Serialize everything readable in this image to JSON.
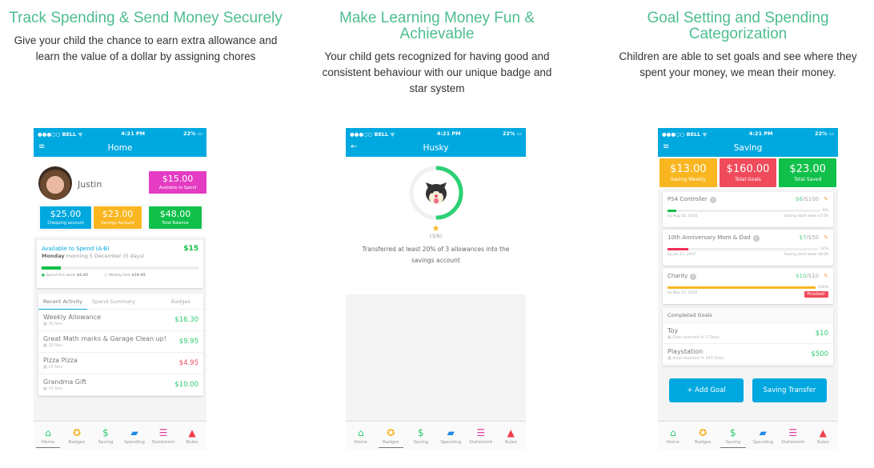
{
  "features": [
    {
      "title": "Track Spending & Send Money Securely",
      "desc": "Give your child the chance to earn extra allowance and learn the value of a dollar by assigning chores"
    },
    {
      "title": "Make Learning Money Fun & Achievable",
      "desc": "Your child gets recognized for having good and consistent behaviour with our unique badge and star system"
    },
    {
      "title": "Goal Setting and Spending Categorization",
      "desc": "Children are able to set goals and see where they spent your money, we mean their money."
    }
  ],
  "status": {
    "carrier": "●●●○○ BELL ᯤ",
    "time": "4:21 PM",
    "battery": "22% ▭"
  },
  "tabs": [
    {
      "label": "Home",
      "icon": "home-icon",
      "glyph": "⌂",
      "color": "#2ecc71"
    },
    {
      "label": "Badges",
      "icon": "badge-icon",
      "glyph": "✪",
      "color": "#f5b223"
    },
    {
      "label": "Saving",
      "icon": "piggy-bank-icon",
      "glyph": "$",
      "color": "#2ecc71"
    },
    {
      "label": "Spending",
      "icon": "card-icon",
      "glyph": "▰",
      "color": "#1e88e5"
    },
    {
      "label": "Statement",
      "icon": "list-icon",
      "glyph": "☰",
      "color": "#e040a0"
    },
    {
      "label": "Rules",
      "icon": "warning-icon",
      "glyph": "▲",
      "color": "#f03c4b"
    }
  ],
  "home": {
    "title": "Home",
    "menu_glyph": "≡",
    "name": "Justin",
    "available": {
      "amount": "$15.00",
      "label": "Available to Spend"
    },
    "balances": [
      {
        "amount": "$25.00",
        "label": "Chequing account",
        "color": "#00a8e0"
      },
      {
        "amount": "$23.00",
        "label": "Savings Account",
        "color": "#f9b620"
      },
      {
        "amount": "$48.00",
        "label": "Total Balance",
        "color": "#10c04a"
      }
    ],
    "spend_card": {
      "title": "Available to Spend (A-B)",
      "amount": "$15",
      "day": "Monday",
      "when": " morning 5 December ",
      "days": "(5 days)",
      "progress": 0.12,
      "spent_label": "Spend this week ",
      "spent": "$4.95",
      "limit_label": "Weekly limit ",
      "limit": "$19.95"
    },
    "activity_tabs": [
      "Recent Activity",
      "Spend Summary",
      "Badges"
    ],
    "activity": [
      {
        "title": "Weekly Allowance",
        "date": "30 Nov",
        "amount": "$16.30",
        "color": "#2ecc71"
      },
      {
        "title": "Great Math marks & Garage Clean up!",
        "date": "29 Nov",
        "amount": "$9.95",
        "color": "#2ecc71"
      },
      {
        "title": "Pizza Pizza",
        "date": "15 Nov",
        "amount": "$4.95",
        "color": "#e74c5c"
      },
      {
        "title": "Grandma Gift",
        "date": "15 Nov",
        "amount": "$10.00",
        "color": "#2ecc71"
      }
    ]
  },
  "husky": {
    "title": "Husky",
    "back_glyph": "←",
    "progress": 0.5,
    "stars": "★",
    "count": "(3/6)",
    "desc": "Transferred at least 20% of 3 allowances into the savings account"
  },
  "saving": {
    "title": "Saving",
    "totals": [
      {
        "amount": "$13.00",
        "label": "Saving Weekly",
        "color": "#f9b620"
      },
      {
        "amount": "$160.00",
        "label": "Total Goals",
        "color": "#f04b5b"
      },
      {
        "amount": "$23.00",
        "label": "Total Saved",
        "color": "#10c04a"
      }
    ],
    "goals": [
      {
        "name": "PS4 Controller",
        "saved": "$6",
        "target": "/$100",
        "pct": "6%",
        "progress": 0.06,
        "color": "#10c04a",
        "due": "by Aug 14, 2016",
        "weekly": "Saving each week $7.00",
        "finished": ""
      },
      {
        "name": "10th Anniversary Mom & Dad",
        "saved": "$7",
        "target": "/$50",
        "pct": "14%",
        "progress": 0.14,
        "color": "#f0305a",
        "due": "by Jan 17, 2017",
        "weekly": "Saving each week $6.00",
        "finished": ""
      },
      {
        "name": "Charity",
        "saved": "$10",
        "target": "/$10",
        "pct": "100%",
        "progress": 1.0,
        "color": "#f9b620",
        "due": "by Nov 15, 2016",
        "weekly": "",
        "finished": "Finished!"
      }
    ],
    "completed_title": "Completed Goals",
    "completed": [
      {
        "name": "Toy",
        "note": "Goal reached in 3 Days",
        "amount": "$10"
      },
      {
        "name": "Playstation",
        "note": "Goal reached in 343 Days",
        "amount": "$500"
      }
    ],
    "add_goal": "+ Add Goal",
    "transfer": "Saving Transfer"
  }
}
